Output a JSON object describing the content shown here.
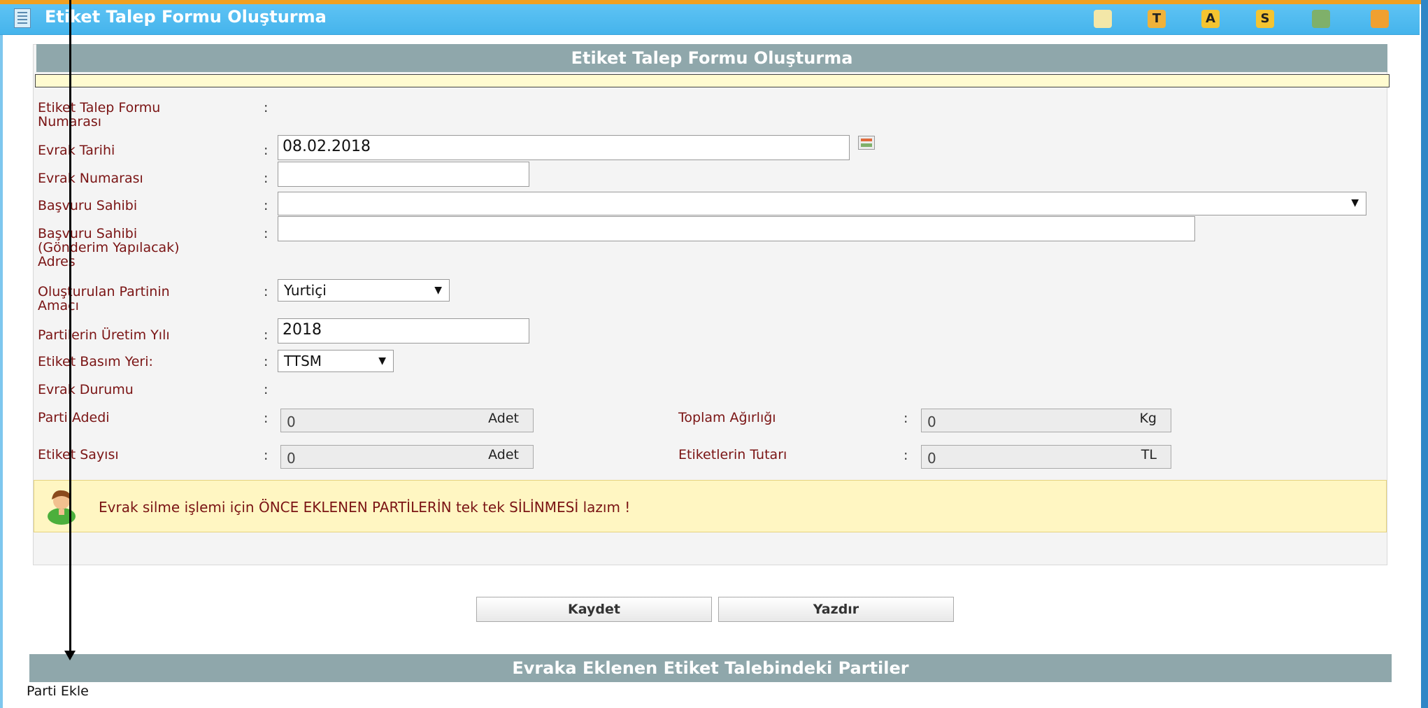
{
  "window": {
    "title": "Etiket Talep Formu Oluşturma",
    "toolbar_icons": [
      {
        "name": "image-icon",
        "glyph": "",
        "bg": "#f3e7a8"
      },
      {
        "name": "t-letter-icon",
        "glyph": "T",
        "bg": "#f0b23a"
      },
      {
        "name": "a-letter-icon",
        "glyph": "A",
        "bg": "#f4c430"
      },
      {
        "name": "s-letter-icon",
        "glyph": "S",
        "bg": "#f4c430"
      },
      {
        "name": "user-icon",
        "glyph": "",
        "bg": "#7fb06a"
      },
      {
        "name": "book-icon",
        "glyph": "",
        "bg": "#f0a030"
      }
    ]
  },
  "form": {
    "header": "Etiket Talep Formu Oluşturma",
    "colon": ":",
    "labels": {
      "form_no_1": "Etiket Talep Formu",
      "form_no_2": "Numarası",
      "evrak_tarihi": "Evrak Tarihi",
      "evrak_numarasi": "Evrak Numarası",
      "basvuru_sahibi": "Başvuru Sahibi",
      "adres_1": "Başvuru Sahibi",
      "adres_2": "(Gönderim Yapılacak)",
      "adres_3": "Adres",
      "amac_1": "Oluşturulan Partinin",
      "amac_2": "Amacı",
      "uretim_yili": "Partilerin Üretim Yılı",
      "basim_yeri": "Etiket Basım Yeri:",
      "evrak_durumu": "Evrak Durumu",
      "parti_adedi": "Parti Adedi",
      "etiket_sayisi": "Etiket Sayısı",
      "toplam_agirlik": "Toplam Ağırlığı",
      "etiket_tutari": "Etiketlerin Tutarı"
    },
    "values": {
      "evrak_tarihi": "08.02.2018",
      "evrak_numarasi": "",
      "basvuru_sahibi": "",
      "adres": "",
      "amac": "Yurtiçi",
      "uretim_yili": "2018",
      "basim_yeri": "TTSM",
      "parti_adedi": "0",
      "etiket_sayisi": "0",
      "toplam_agirlik": "0",
      "etiket_tutari": "0"
    },
    "units": {
      "adet": "Adet",
      "kg": "Kg",
      "tl": "TL"
    },
    "dropdown_arrow": "▼",
    "warning": "Evrak silme işlemi için ÖNCE EKLENEN PARTİLERİN tek tek SİLİNMESİ lazım !"
  },
  "buttons": {
    "save": "Kaydet",
    "print": "Yazdır"
  },
  "parties": {
    "header": "Evraka Eklenen Etiket Talebindeki Partiler",
    "add_link": "Parti Ekle"
  }
}
